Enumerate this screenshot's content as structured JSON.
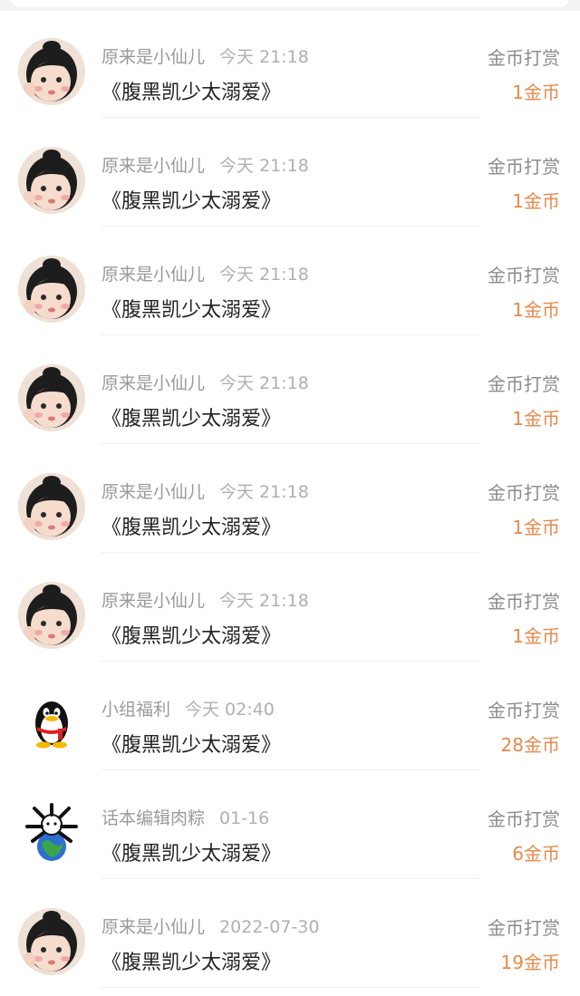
{
  "items": [
    {
      "avatar": "girl-avatar",
      "name": "原来是小仙儿",
      "time": "今天 21:18",
      "title": "《腹黑凯少太溺爱》",
      "action": "金币打赏",
      "amount": "1金币"
    },
    {
      "avatar": "girl-avatar",
      "name": "原来是小仙儿",
      "time": "今天 21:18",
      "title": "《腹黑凯少太溺爱》",
      "action": "金币打赏",
      "amount": "1金币"
    },
    {
      "avatar": "girl-avatar",
      "name": "原来是小仙儿",
      "time": "今天 21:18",
      "title": "《腹黑凯少太溺爱》",
      "action": "金币打赏",
      "amount": "1金币"
    },
    {
      "avatar": "girl-avatar",
      "name": "原来是小仙儿",
      "time": "今天 21:18",
      "title": "《腹黑凯少太溺爱》",
      "action": "金币打赏",
      "amount": "1金币"
    },
    {
      "avatar": "girl-avatar",
      "name": "原来是小仙儿",
      "time": "今天 21:18",
      "title": "《腹黑凯少太溺爱》",
      "action": "金币打赏",
      "amount": "1金币"
    },
    {
      "avatar": "girl-avatar",
      "name": "原来是小仙儿",
      "time": "今天 21:18",
      "title": "《腹黑凯少太溺爱》",
      "action": "金币打赏",
      "amount": "1金币"
    },
    {
      "avatar": "penguin-avatar",
      "name": "小组福利",
      "time": "今天 02:40",
      "title": "《腹黑凯少太溺爱》",
      "action": "金币打赏",
      "amount": "28金币"
    },
    {
      "avatar": "globe-creature-avatar",
      "name": "话本编辑肉粽",
      "time": "01-16",
      "title": "《腹黑凯少太溺爱》",
      "action": "金币打赏",
      "amount": "6金币"
    },
    {
      "avatar": "girl-avatar",
      "name": "原来是小仙儿",
      "time": "2022-07-30",
      "title": "《腹黑凯少太溺爱》",
      "action": "金币打赏",
      "amount": "19金币"
    }
  ],
  "colors": {
    "amount": "#e8894a",
    "meta": "#9a9a9a",
    "title": "#222222",
    "background": "#ffffff"
  }
}
